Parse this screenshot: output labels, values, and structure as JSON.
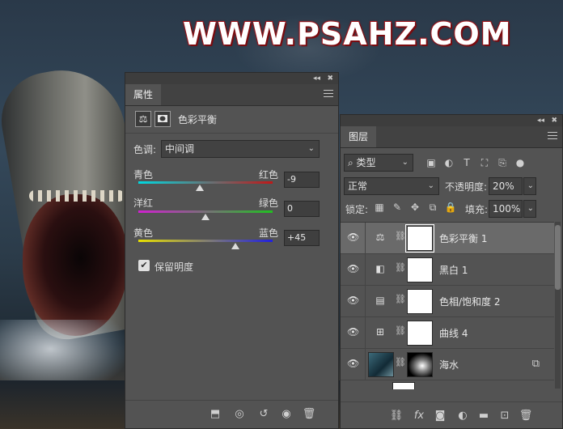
{
  "watermark": "WWW.PSAHZ.COM",
  "properties_panel": {
    "tab": "属性",
    "adjustment_title": "色彩平衡",
    "tone_label": "色调:",
    "tone_value": "中间调",
    "sliders": [
      {
        "left": "青色",
        "right": "红色",
        "value": "-9",
        "level": -9
      },
      {
        "left": "洋红",
        "right": "绿色",
        "value": "0",
        "level": 0
      },
      {
        "left": "黄色",
        "right": "蓝色",
        "value": "+45",
        "level": 45
      }
    ],
    "preserve_luminosity": "保留明度",
    "preserve_checked": true
  },
  "layers_panel": {
    "tab": "图层",
    "filter_kind": "类型",
    "blend_mode": "正常",
    "opacity_label": "不透明度:",
    "opacity_value": "20%",
    "lock_label": "锁定:",
    "fill_label": "填充:",
    "fill_value": "100%",
    "layers": [
      {
        "name": "色彩平衡 1",
        "icon": "scales-icon",
        "selected": true
      },
      {
        "name": "黑白 1",
        "icon": "black-white-icon",
        "selected": false
      },
      {
        "name": "色相/饱和度 2",
        "icon": "hue-saturation-icon",
        "selected": false
      },
      {
        "name": "曲线 4",
        "icon": "curves-icon",
        "selected": false
      },
      {
        "name": "海水",
        "icon": "image-thumbnail",
        "selected": false
      }
    ]
  },
  "colors": {
    "panel_bg": "#535353",
    "selected_row": "#6a6a6a",
    "watermark_stroke": "#b0151c"
  }
}
